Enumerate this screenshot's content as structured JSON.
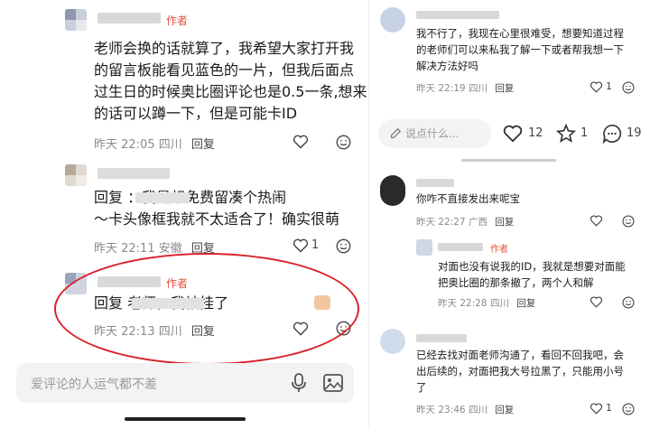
{
  "left": {
    "comments": [
      {
        "author_tag": "作者",
        "text_lines": [
          "老师会换的话就算了，我希望大家打开我",
          "的留言板能看见蓝色的一片，但我后面点",
          "过生日的时候奥比圈评论也是0.5一条,想来",
          "的话可以蹲一下，但是可能卡ID"
        ],
        "time": "昨天 22:05",
        "location": "四川",
        "reply_label": "回复"
      },
      {
        "text_lines": [
          "回复               ：我是想免费留凑个热闹",
          "～卡头像框我就不太适合了！确实很萌"
        ],
        "time": "昨天 22:11",
        "location": "安徽",
        "reply_label": "回复",
        "likes": "1"
      },
      {
        "author_tag": "作者",
        "text_lines": [
          "回复                        老师，我被挂了"
        ],
        "time": "昨天 22:13",
        "location": "四川",
        "reply_label": "回复"
      }
    ],
    "input_placeholder": "爱评论的人运气都不差"
  },
  "right": {
    "top_comment": {
      "text_lines": [
        "我不行了，我现在心里很难受，想要知道过程",
        "的老师们可以来私我了解一下或者帮我想一下",
        "解决方法好吗"
      ],
      "time": "昨天 22:19",
      "location": "四川",
      "reply_label": "回复",
      "likes": "1"
    },
    "action_bar": {
      "placeholder": "说点什么...",
      "likes": "12",
      "favorites": "1",
      "comments": "19"
    },
    "comments": [
      {
        "text_lines": [
          "你咋不直接发出来呢宝"
        ],
        "time": "昨天 22:27",
        "location": "广西",
        "reply_label": "回复"
      },
      {
        "author_tag": "作者",
        "text_lines": [
          "对面也没有说我的ID，我就是想要对面能",
          "把奥比圈的那条撤了，两个人和解"
        ],
        "time": "昨天 22:28",
        "location": "四川",
        "reply_label": "回复"
      },
      {
        "text_lines": [
          "已经去找对面老师沟通了，看回不回我吧，会",
          "出后续的，对面把我大号拉黑了，只能用小号",
          "了"
        ],
        "time": "昨天 23:46",
        "location": "四川",
        "reply_label": "回复",
        "likes": "1"
      }
    ]
  },
  "colors": {
    "accent_red": "#e0503a",
    "highlight_red": "#d8222a"
  }
}
